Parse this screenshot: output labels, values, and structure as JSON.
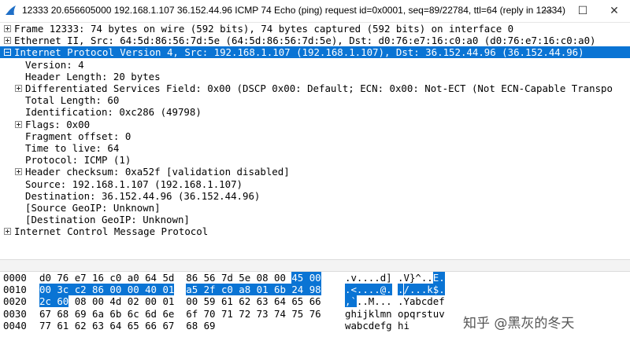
{
  "window": {
    "title": "12333 20.656605000 192.168.1.107 36.152.44.96 ICMP 74 Echo (ping) request  id=0x0001, seq=89/22784, ttl=64 (reply in 12334)",
    "minimize": "—",
    "maximize": "☐",
    "close": "✕"
  },
  "colors": {
    "selection": "#0a74d4",
    "shark_fin": "#1f6fc7"
  },
  "tree": [
    {
      "text": "Frame 12333: 74 bytes on wire (592 bits), 74 bytes captured (592 bits) on interface 0",
      "expander": "plus",
      "indent": 0,
      "selected": false
    },
    {
      "text": "Ethernet II, Src: 64:5d:86:56:7d:5e (64:5d:86:56:7d:5e), Dst: d0:76:e7:16:c0:a0 (d0:76:e7:16:c0:a0)",
      "expander": "plus",
      "indent": 0,
      "selected": false
    },
    {
      "text": "Internet Protocol Version 4, Src: 192.168.1.107 (192.168.1.107), Dst: 36.152.44.96 (36.152.44.96)",
      "expander": "minus",
      "indent": 0,
      "selected": true
    },
    {
      "text": "Version: 4",
      "expander": "",
      "indent": 1,
      "selected": false
    },
    {
      "text": "Header Length: 20 bytes",
      "expander": "",
      "indent": 1,
      "selected": false
    },
    {
      "text": "Differentiated Services Field: 0x00 (DSCP 0x00: Default; ECN: 0x00: Not-ECT (Not ECN-Capable Transpo",
      "expander": "plus",
      "indent": 1,
      "selected": false
    },
    {
      "text": "Total Length: 60",
      "expander": "",
      "indent": 1,
      "selected": false
    },
    {
      "text": "Identification: 0xc286 (49798)",
      "expander": "",
      "indent": 1,
      "selected": false
    },
    {
      "text": "Flags: 0x00",
      "expander": "plus",
      "indent": 1,
      "selected": false
    },
    {
      "text": "Fragment offset: 0",
      "expander": "",
      "indent": 1,
      "selected": false
    },
    {
      "text": "Time to live: 64",
      "expander": "",
      "indent": 1,
      "selected": false
    },
    {
      "text": "Protocol: ICMP (1)",
      "expander": "",
      "indent": 1,
      "selected": false
    },
    {
      "text": "Header checksum: 0xa52f [validation disabled]",
      "expander": "plus",
      "indent": 1,
      "selected": false
    },
    {
      "text": "Source: 192.168.1.107 (192.168.1.107)",
      "expander": "",
      "indent": 1,
      "selected": false
    },
    {
      "text": "Destination: 36.152.44.96 (36.152.44.96)",
      "expander": "",
      "indent": 1,
      "selected": false
    },
    {
      "text": "[Source GeoIP: Unknown]",
      "expander": "",
      "indent": 1,
      "selected": false
    },
    {
      "text": "[Destination GeoIP: Unknown]",
      "expander": "",
      "indent": 1,
      "selected": false
    },
    {
      "text": "Internet Control Message Protocol",
      "expander": "plus",
      "indent": 0,
      "selected": false
    }
  ],
  "bytes": [
    {
      "offset": "0000",
      "hex": [
        "d0",
        "76",
        "e7",
        "16",
        "c0",
        "a0",
        "64",
        "5d",
        "86",
        "56",
        "7d",
        "5e",
        "08",
        "00",
        "45",
        "00"
      ],
      "ascii": ".v....d] .V}^..E.",
      "hl_start": 14,
      "hl_end": 16
    },
    {
      "offset": "0010",
      "hex": [
        "00",
        "3c",
        "c2",
        "86",
        "00",
        "00",
        "40",
        "01",
        "a5",
        "2f",
        "c0",
        "a8",
        "01",
        "6b",
        "24",
        "98"
      ],
      "ascii": ".<....@. ./...k$.",
      "hl_start": 0,
      "hl_end": 16
    },
    {
      "offset": "0020",
      "hex": [
        "2c",
        "60",
        "08",
        "00",
        "4d",
        "02",
        "00",
        "01",
        "00",
        "59",
        "61",
        "62",
        "63",
        "64",
        "65",
        "66"
      ],
      "ascii": ",`..M... .Yabcdef",
      "hl_start": 0,
      "hl_end": 2
    },
    {
      "offset": "0030",
      "hex": [
        "67",
        "68",
        "69",
        "6a",
        "6b",
        "6c",
        "6d",
        "6e",
        "6f",
        "70",
        "71",
        "72",
        "73",
        "74",
        "75",
        "76"
      ],
      "ascii": "ghijklmn opqrstuv",
      "hl_start": 0,
      "hl_end": 0
    },
    {
      "offset": "0040",
      "hex": [
        "77",
        "61",
        "62",
        "63",
        "64",
        "65",
        "66",
        "67",
        "68",
        "69"
      ],
      "ascii": "wabcdefg hi",
      "hl_start": 0,
      "hl_end": 0
    }
  ],
  "watermark": "知乎 @黑灰的冬天"
}
